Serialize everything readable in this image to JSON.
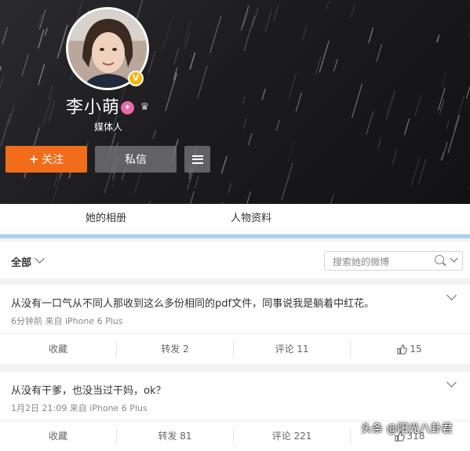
{
  "profile": {
    "name": "李小萌",
    "verified_badge": "V",
    "talent_icon": "talent-icon",
    "crown_icon": "crown-icon",
    "subtitle": "媒体人"
  },
  "buttons": {
    "follow_plus": "+",
    "follow_label": "关注",
    "message_label": "私信",
    "menu_icon": "menu-icon"
  },
  "tabs": [
    "她的相册",
    "人物资料"
  ],
  "filter": {
    "label": "全部",
    "search_placeholder": "搜索她的微博"
  },
  "posts": [
    {
      "text": "从没有一口气从不同人那收到这么多份相同的pdf文件，同事说我是躺着中红花。",
      "meta": "6分钟前 来自 iPhone 6 Plus",
      "actions": {
        "collect": "收藏",
        "repost": "转发 2",
        "comment": "评论 11",
        "like": "15"
      }
    },
    {
      "text": "从没有干爹，也没当过干妈，ok？",
      "meta": "1月2日 21:09 来自 iPhone 6 Plus",
      "actions": {
        "collect": "收藏",
        "repost": "转发 81",
        "comment": "评论 221",
        "like": "318"
      }
    }
  ],
  "watermark": "头条 @阳光八卦君",
  "colors": {
    "follow_orange": "#f26d1b",
    "badge_gold": "#f7b500",
    "divider_blue": "#a9d3ef"
  }
}
